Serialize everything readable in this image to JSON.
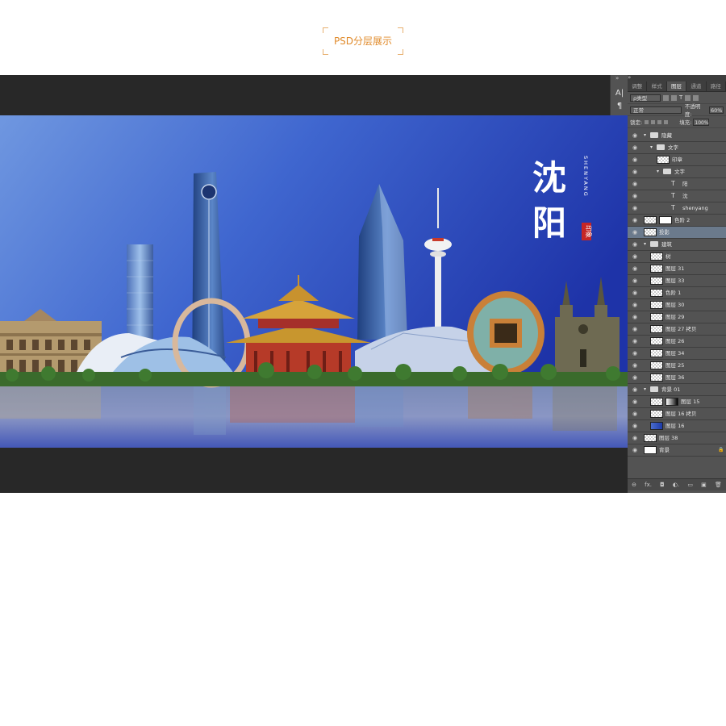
{
  "header": {
    "title": "PSD分层展示"
  },
  "artwork": {
    "title_chars": [
      "沈",
      "阳"
    ],
    "subtitle": "SHENYANG",
    "seal": "印象"
  },
  "tools": {
    "collapse": "»",
    "char_tool": "A|",
    "para_tool": "¶"
  },
  "panel": {
    "collapse": "»",
    "tabs": [
      "调整",
      "样式",
      "图层",
      "通道",
      "路径"
    ],
    "active_tab": 2,
    "filter_label": "ρ类型",
    "blend_mode": "正常",
    "opacity_label": "不透明度:",
    "opacity_value": "60%",
    "lock_label": "锁定:",
    "fill_label": "填充:",
    "fill_value": "100%",
    "footer_icons": [
      "link-icon",
      "fx-icon",
      "mask-icon",
      "adjustment-icon",
      "folder-icon",
      "new-layer-icon",
      "trash-icon"
    ],
    "footer_labels": [
      "⊖",
      "fx.",
      "◘",
      "◐.",
      "▭",
      "▣",
      "🗑"
    ]
  },
  "layers": [
    {
      "name": "隐藏",
      "type": "group",
      "depth": 0,
      "eye": true
    },
    {
      "name": "文字",
      "type": "group",
      "depth": 1,
      "eye": true
    },
    {
      "name": "印章",
      "type": "pixel",
      "depth": 2,
      "eye": true
    },
    {
      "name": "文字",
      "type": "group",
      "depth": 2,
      "eye": true
    },
    {
      "name": "阳",
      "type": "text",
      "depth": 3,
      "eye": true
    },
    {
      "name": "沈",
      "type": "text",
      "depth": 3,
      "eye": true
    },
    {
      "name": "shenyang",
      "type": "text",
      "depth": 3,
      "eye": true
    },
    {
      "name": "色阶 2",
      "type": "adjust",
      "depth": 0,
      "eye": true
    },
    {
      "name": "投影",
      "type": "pixel",
      "depth": 0,
      "eye": true,
      "active": true
    },
    {
      "name": "建筑",
      "type": "group",
      "depth": 0,
      "eye": true
    },
    {
      "name": "树",
      "type": "pixel",
      "depth": 1,
      "eye": true
    },
    {
      "name": "图层 31",
      "type": "pixel",
      "depth": 1,
      "eye": true
    },
    {
      "name": "图层 33",
      "type": "pixel",
      "depth": 1,
      "eye": true
    },
    {
      "name": "色阶 1",
      "type": "pixel",
      "depth": 1,
      "eye": true
    },
    {
      "name": "图层 30",
      "type": "pixel",
      "depth": 1,
      "eye": true
    },
    {
      "name": "图层 29",
      "type": "pixel",
      "depth": 1,
      "eye": true
    },
    {
      "name": "图层 27 拷贝",
      "type": "pixel",
      "depth": 1,
      "eye": true
    },
    {
      "name": "图层 26",
      "type": "pixel",
      "depth": 1,
      "eye": true
    },
    {
      "name": "图层 34",
      "type": "pixel",
      "depth": 1,
      "eye": true
    },
    {
      "name": "图层 25",
      "type": "pixel",
      "depth": 1,
      "eye": true
    },
    {
      "name": "图层 36",
      "type": "pixel",
      "depth": 1,
      "eye": true
    },
    {
      "name": "背景 01",
      "type": "group",
      "depth": 0,
      "eye": true
    },
    {
      "name": "图层 15",
      "type": "masked",
      "depth": 1,
      "eye": true
    },
    {
      "name": "图层 16 拷贝",
      "type": "pixel",
      "depth": 1,
      "eye": true
    },
    {
      "name": "图层 16",
      "type": "blue",
      "depth": 1,
      "eye": true
    },
    {
      "name": "图层 38",
      "type": "pixel",
      "depth": 0,
      "eye": true
    },
    {
      "name": "背景",
      "type": "bg",
      "depth": 0,
      "eye": true
    }
  ]
}
